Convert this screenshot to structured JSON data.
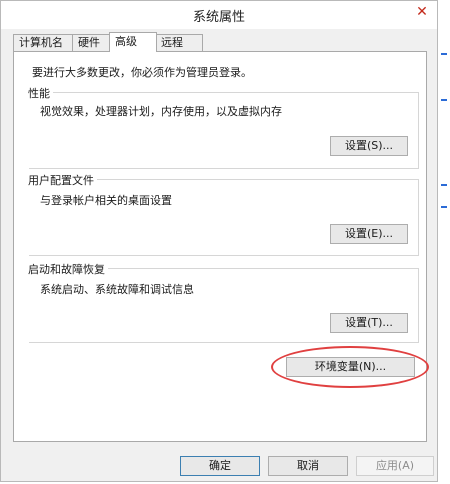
{
  "window": {
    "title": "系统属性",
    "close_symbol": "✕"
  },
  "tabs": [
    {
      "label": "计算机名",
      "active": false
    },
    {
      "label": "硬件",
      "active": false
    },
    {
      "label": "高级",
      "active": true
    },
    {
      "label": "远程",
      "active": false
    }
  ],
  "intro_text": "要进行大多数更改，你必须作为管理员登录。",
  "groups": {
    "performance": {
      "title": "性能",
      "description": "视觉效果，处理器计划，内存使用，以及虚拟内存",
      "button": "设置(S)..."
    },
    "user_profiles": {
      "title": "用户配置文件",
      "description": "与登录帐户相关的桌面设置",
      "button": "设置(E)..."
    },
    "startup_recovery": {
      "title": "启动和故障恢复",
      "description": "系统启动、系统故障和调试信息",
      "button": "设置(T)..."
    }
  },
  "env_button": "环境变量(N)...",
  "footer": {
    "ok": "确定",
    "cancel": "取消",
    "apply": "应用(A)"
  },
  "colors": {
    "highlight": "#e04040",
    "window_bg": "#f0f0f0",
    "panel_bg": "#ffffff"
  }
}
